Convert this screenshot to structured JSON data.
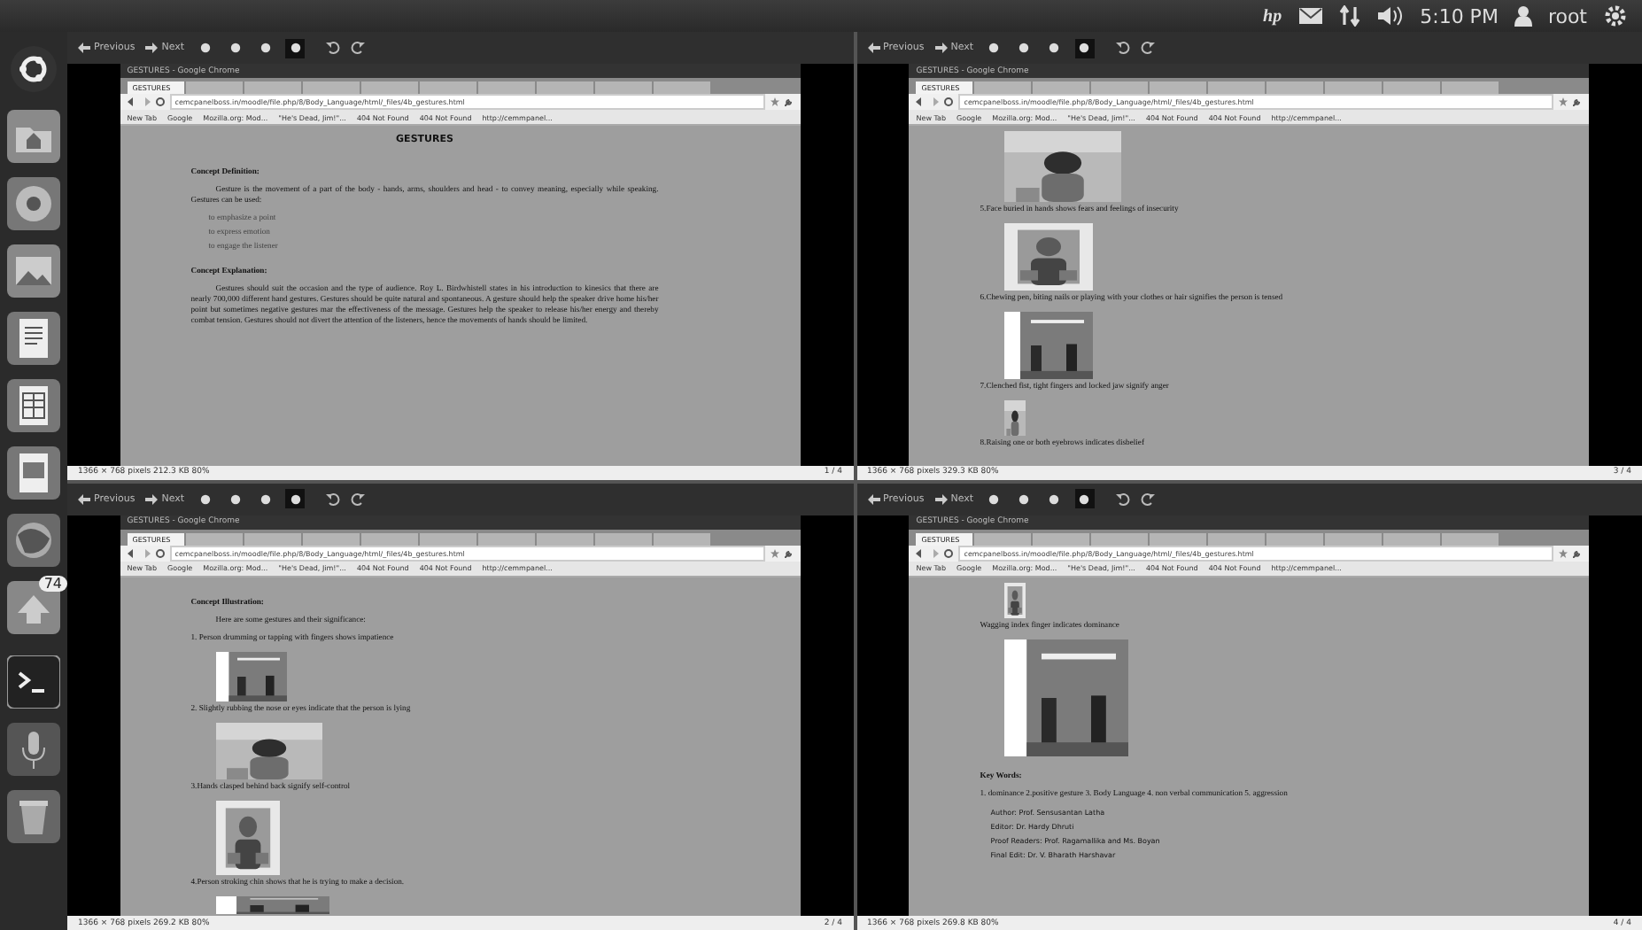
{
  "top_panel": {
    "logo": "hp",
    "clock": "5:10 PM",
    "user": "root"
  },
  "launcher": {
    "items": [
      {
        "kind": "dash"
      },
      {
        "kind": "folder"
      },
      {
        "kind": "browser"
      },
      {
        "kind": "photos"
      },
      {
        "kind": "writer"
      },
      {
        "kind": "calc"
      },
      {
        "kind": "impress"
      },
      {
        "kind": "firefox"
      },
      {
        "kind": "updates",
        "badge": "74"
      },
      {
        "kind": "terminal"
      },
      {
        "kind": "mic"
      },
      {
        "kind": "trash"
      }
    ]
  },
  "viewers": [
    {
      "toolbar": {
        "previous": "Previous",
        "next": "Next",
        "zoom_buttons": [
          {
            "selected": false
          },
          {
            "selected": false
          },
          {
            "selected": false
          },
          {
            "selected": true
          }
        ]
      },
      "browser": {
        "title": "GESTURES - Google Chrome",
        "tabs": [
          {
            "label": "GESTURES",
            "selected": true
          },
          {
            "selected": false
          },
          {
            "selected": false
          },
          {
            "selected": false
          },
          {
            "selected": false
          },
          {
            "selected": false
          },
          {
            "selected": false
          },
          {
            "selected": false
          },
          {
            "selected": false
          },
          {
            "selected": false
          }
        ],
        "address": "cemcpanelboss.in/moodle/file.php/8/Body_Language/html/_files/4b_gestures.html",
        "bookmarks": [
          "New Tab",
          "Google",
          "Mozilla.org: Mod...",
          "\"He's Dead, Jim!\"...",
          "404 Not Found",
          "404 Not Found",
          "http://cemmpanel..."
        ],
        "content": [
          {
            "kind": "title",
            "text": "GESTURES"
          },
          {
            "kind": "heading",
            "text": "Concept Definition:"
          },
          {
            "kind": "paragraph",
            "text": "Gesture is the movement of a part of the body - hands, arms, shoulders and head - to convey meaning, especially while speaking. Gestures can be used:"
          },
          {
            "kind": "bullet",
            "text": "to emphasize a point"
          },
          {
            "kind": "bullet",
            "text": "to express emotion"
          },
          {
            "kind": "bullet",
            "text": "to engage the listener"
          },
          {
            "kind": "heading",
            "text": "Concept Explanation:"
          },
          {
            "kind": "paragraph",
            "text": "Gestures should suit the occasion and the type of audience. Roy L. Birdwhistell states in his introduction to kinesics that there are nearly 700,000 different hand gestures. Gestures should be quite natural and spontaneous. A gesture should help the speaker drive home his/her point but sometimes negative gestures mar the effectiveness of the message. Gestures help the speaker to release his/her energy and thereby combat tension. Gestures should not divert the attention of the listeners, hence the movements of hands should be limited."
          }
        ]
      },
      "status": {
        "info": "1366 × 768 pixels   212.3 KB   80%",
        "page": "1 / 4"
      }
    },
    {
      "toolbar": {
        "previous": "Previous",
        "next": "Next",
        "zoom_buttons": [
          {
            "selected": false
          },
          {
            "selected": false
          },
          {
            "selected": false
          },
          {
            "selected": true
          }
        ]
      },
      "browser": {
        "title": "GESTURES - Google Chrome",
        "tabs": [
          {
            "label": "GESTURES",
            "selected": true
          },
          {
            "selected": false
          },
          {
            "selected": false
          },
          {
            "selected": false
          },
          {
            "selected": false
          },
          {
            "selected": false
          },
          {
            "selected": false
          },
          {
            "selected": false
          },
          {
            "selected": false
          },
          {
            "selected": false
          }
        ],
        "address": "cemcpanelboss.in/moodle/file.php/8/Body_Language/html/_files/4b_gestures.html",
        "bookmarks": [
          "New Tab",
          "Google",
          "Mozilla.org: Mod...",
          "\"He's Dead, Jim!\"...",
          "404 Not Found",
          "404 Not Found",
          "http://cemmpanel..."
        ],
        "content": [
          {
            "kind": "picture"
          },
          {
            "kind": "caption",
            "text": "5.Face buried in hands shows fears and feelings of insecurity"
          },
          {
            "kind": "picture"
          },
          {
            "kind": "caption",
            "text": "6.Chewing pen, biting nails or playing with your clothes or hair signifies the person is tensed"
          },
          {
            "kind": "picture"
          },
          {
            "kind": "caption",
            "text": "7.Clenched fist, tight fingers and locked jaw signify anger"
          },
          {
            "kind": "picture"
          },
          {
            "kind": "caption",
            "text": "8.Raising one or both eyebrows indicates disbelief"
          }
        ]
      },
      "status": {
        "info": "1366 × 768 pixels   329.3 KB   80%",
        "page": "3 / 4"
      }
    },
    {
      "toolbar": {
        "previous": "Previous",
        "next": "Next",
        "zoom_buttons": [
          {
            "selected": false
          },
          {
            "selected": false
          },
          {
            "selected": false
          },
          {
            "selected": true
          }
        ]
      },
      "browser": {
        "title": "GESTURES - Google Chrome",
        "tabs": [
          {
            "label": "GESTURES",
            "selected": true
          },
          {
            "selected": false
          },
          {
            "selected": false
          },
          {
            "selected": false
          },
          {
            "selected": false
          },
          {
            "selected": false
          },
          {
            "selected": false
          },
          {
            "selected": false
          },
          {
            "selected": false
          },
          {
            "selected": false
          }
        ],
        "address": "cemcpanelboss.in/moodle/file.php/8/Body_Language/html/_files/4b_gestures.html",
        "bookmarks": [
          "New Tab",
          "Google",
          "Mozilla.org: Mod...",
          "\"He's Dead, Jim!\"...",
          "404 Not Found",
          "404 Not Found",
          "http://cemmpanel..."
        ],
        "content": [
          {
            "kind": "heading",
            "text": "Concept Illustration:"
          },
          {
            "kind": "paragraph",
            "text": "Here are some gestures and their significance:"
          },
          {
            "kind": "caption",
            "text": "1. Person drumming or tapping with fingers shows impatience"
          },
          {
            "kind": "picture"
          },
          {
            "kind": "caption",
            "text": "2. Slightly rubbing the nose or eyes indicate that the person is lying"
          },
          {
            "kind": "picture"
          },
          {
            "kind": "caption",
            "text": "3.Hands clasped behind back signify self-control"
          },
          {
            "kind": "picture"
          },
          {
            "kind": "caption",
            "text": "4.Person stroking chin shows that he is trying to make a decision."
          },
          {
            "kind": "picture"
          }
        ]
      },
      "status": {
        "info": "1366 × 768 pixels   269.2 KB   80%",
        "page": "2 / 4"
      }
    },
    {
      "toolbar": {
        "previous": "Previous",
        "next": "Next",
        "zoom_buttons": [
          {
            "selected": false
          },
          {
            "selected": false
          },
          {
            "selected": false
          },
          {
            "selected": true
          }
        ]
      },
      "browser": {
        "title": "GESTURES - Google Chrome",
        "tabs": [
          {
            "label": "GESTURES",
            "selected": true
          },
          {
            "selected": false
          },
          {
            "selected": false
          },
          {
            "selected": false
          },
          {
            "selected": false
          },
          {
            "selected": false
          },
          {
            "selected": false
          },
          {
            "selected": false
          },
          {
            "selected": false
          },
          {
            "selected": false
          }
        ],
        "address": "cemcpanelboss.in/moodle/file.php/8/Body_Language/html/_files/4b_gestures.html",
        "bookmarks": [
          "New Tab",
          "Google",
          "Mozilla.org: Mod...",
          "\"He's Dead, Jim!\"...",
          "404 Not Found",
          "404 Not Found",
          "http://cemmpanel..."
        ],
        "content": [
          {
            "kind": "picture"
          },
          {
            "kind": "caption",
            "text": "Wagging index finger indicates dominance"
          },
          {
            "kind": "picture"
          },
          {
            "kind": "heading",
            "text": "Key Words:"
          },
          {
            "kind": "caption",
            "text": "1. dominance 2.positive gesture 3. Body Language 4. non verbal communication 5. aggression"
          },
          {
            "kind": "credit",
            "text": "Author: Prof. Sensusantan Latha"
          },
          {
            "kind": "credit",
            "text": "Editor: Dr. Hardy Dhruti"
          },
          {
            "kind": "credit",
            "text": "Proof Readers: Prof. Ragamallika and Ms. Boyan"
          },
          {
            "kind": "credit",
            "text": "Final Edit: Dr. V. Bharath Harshavar"
          }
        ]
      },
      "status": {
        "info": "1366 × 768 pixels   269.8 KB   80%",
        "page": "4 / 4"
      }
    }
  ]
}
